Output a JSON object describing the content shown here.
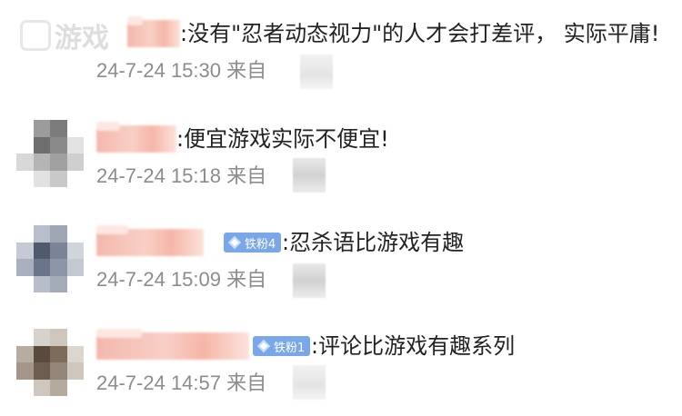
{
  "watermark": "游戏",
  "comments": [
    {
      "text": ":没有\"忍者动态视力\"的人才会打差评， 实际平庸!",
      "date": "24-7-24 15:30",
      "source_label": "来自",
      "badge": null
    },
    {
      "text": ":便宜游戏实际不便宜!",
      "date": "24-7-24 15:18",
      "source_label": "来自",
      "badge": null
    },
    {
      "text": ":忍杀语比游戏有趣",
      "date": "24-7-24 15:09",
      "source_label": "来自",
      "badge": "铁粉4"
    },
    {
      "text": ":评论比游戏有趣系列",
      "date": "24-7-24 14:57",
      "source_label": "来自",
      "badge": "铁粉1"
    }
  ],
  "colors": {
    "text": "#222222",
    "meta": "#8c8c8c",
    "badge": "#79a7e8",
    "name_blur": "#f4b8ad"
  }
}
